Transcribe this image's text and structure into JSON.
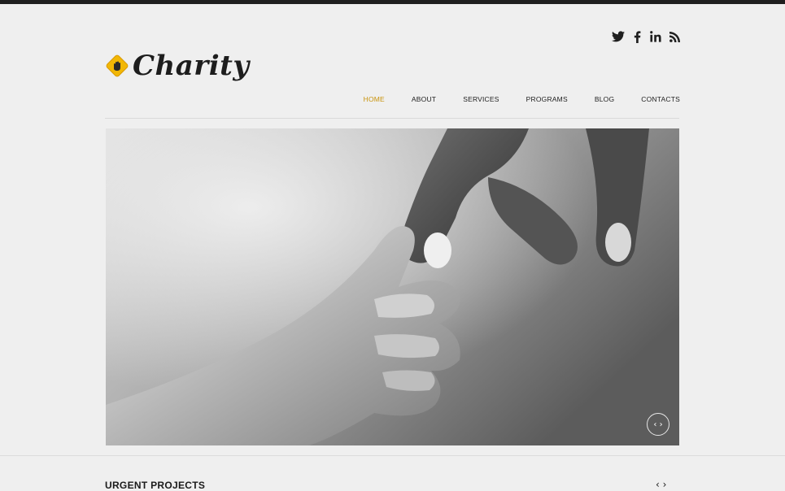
{
  "brand": {
    "name": "Charity",
    "accent_color": "#f2b705",
    "badge_icon": "hand-icon"
  },
  "social": [
    {
      "name": "twitter-icon",
      "glyph": "twitter"
    },
    {
      "name": "facebook-icon",
      "glyph": "f"
    },
    {
      "name": "linkedin-icon",
      "glyph": "in"
    },
    {
      "name": "rss-icon",
      "glyph": "rss"
    }
  ],
  "nav": {
    "items": [
      {
        "label": "HOME",
        "active": true
      },
      {
        "label": "ABOUT",
        "active": false
      },
      {
        "label": "SERVICES",
        "active": false
      },
      {
        "label": "PROGRAMS",
        "active": false
      },
      {
        "label": "BLOG",
        "active": false
      },
      {
        "label": "CONTACTS",
        "active": false
      }
    ],
    "active_color": "#c9930c"
  },
  "hero": {
    "controls_glyph": "‹ ›",
    "controls_icon": "slider-arrows-icon"
  },
  "section": {
    "title": "URGENT PROJECTS",
    "arrows_glyph": "‹ ›"
  }
}
